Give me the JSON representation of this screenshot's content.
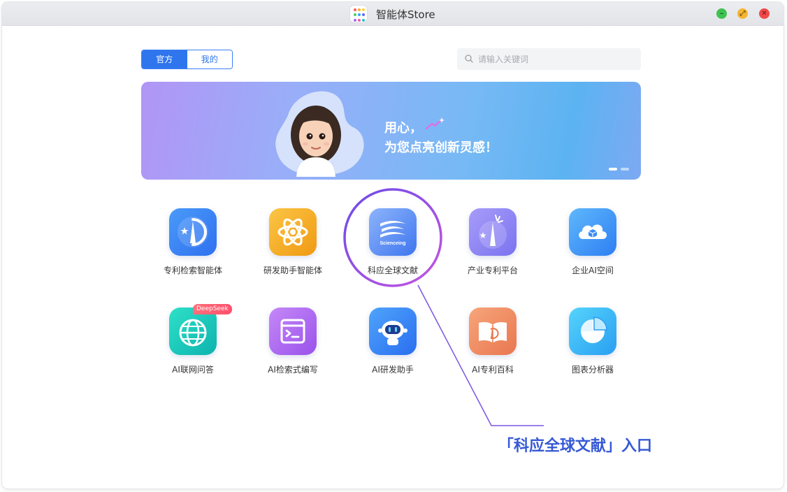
{
  "window": {
    "title": "智能体Store",
    "min_glyph": "–",
    "max_glyph": "⤢",
    "close_glyph": "✕"
  },
  "tabs": [
    {
      "label": "官方",
      "selected": true
    },
    {
      "label": "我的",
      "selected": false
    }
  ],
  "search": {
    "placeholder": "请输入关键词",
    "value": ""
  },
  "banner": {
    "line1": "用心，",
    "line2": "为您点亮创新灵感！",
    "slide_count": 2,
    "active_slide": 1
  },
  "apps": [
    {
      "label": "专利检索智能体",
      "icon": "compass-star-icon",
      "color": "#3a86f5"
    },
    {
      "label": "研发助手智能体",
      "icon": "atom-icon",
      "color": "#f2a81c"
    },
    {
      "label": "科应全球文献",
      "icon": "scienceing-icon",
      "icon_text": "Scienceing",
      "color": "#5d8cf6"
    },
    {
      "label": "产业专利平台",
      "icon": "compass-sparkle-icon",
      "color": "#8f86f5"
    },
    {
      "label": "企业AI空间",
      "icon": "cloud-cube-icon",
      "color": "#3a9af5"
    },
    {
      "label": "AI联网问答",
      "icon": "globe-icon",
      "color": "#14c7b8",
      "badge": "DeepSeek"
    },
    {
      "label": "AI检索式编写",
      "icon": "terminal-window-icon",
      "color": "#b06af0"
    },
    {
      "label": "AI研发助手",
      "icon": "robot-icon",
      "color": "#3b8ff5"
    },
    {
      "label": "AI专利百科",
      "icon": "book-icon",
      "color": "#f08a5a"
    },
    {
      "label": "图表分析器",
      "icon": "pie-chart-icon",
      "color": "#2fb8f0"
    }
  ],
  "annotation": {
    "text": "「科应全球文献」入口",
    "color": "#3659d6",
    "circle_color": "#a54de0"
  }
}
